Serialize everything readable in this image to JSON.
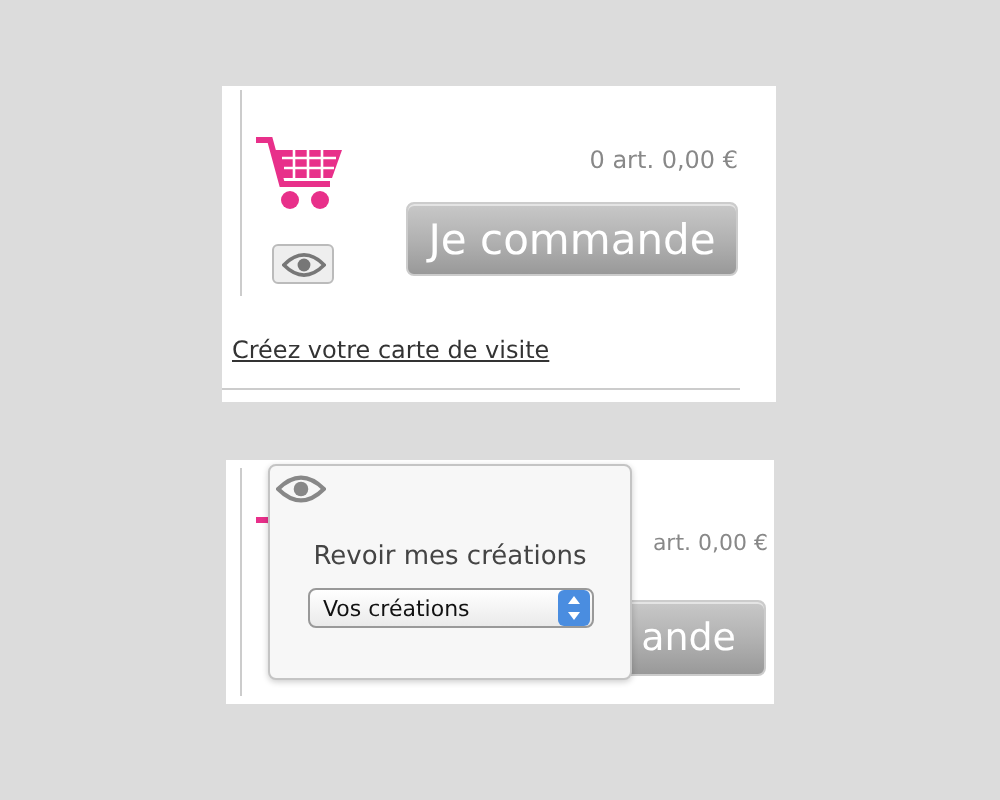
{
  "order_panel": {
    "summary": "0 art. 0,00 €",
    "order_button": "Je commande",
    "link": "Créez votre carte de visite"
  },
  "preview_panel": {
    "summary": "art. 0,00 €",
    "order_button": "ande",
    "popover": {
      "title": "Revoir mes créations",
      "select": {
        "value": "Vos créations"
      }
    }
  }
}
